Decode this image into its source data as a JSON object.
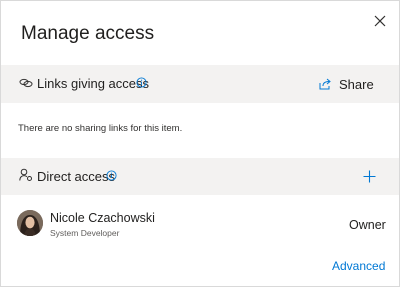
{
  "dialog": {
    "title": "Manage access",
    "close_icon": "close-icon"
  },
  "links_section": {
    "label": "Links giving access",
    "icon": "link-icon",
    "info_icon": "info-icon",
    "share_label": "Share",
    "share_icon": "share-icon",
    "empty_message": "There are no sharing links for this item."
  },
  "direct_section": {
    "label": "Direct access",
    "icon": "person-key-icon",
    "info_icon": "info-icon",
    "add_icon": "plus-icon"
  },
  "people": [
    {
      "name": "Nicole Czachowski",
      "title": "System Developer",
      "role": "Owner"
    }
  ],
  "footer": {
    "advanced_label": "Advanced"
  },
  "colors": {
    "accent": "#0078d4",
    "section_bg": "#f3f2f1"
  }
}
